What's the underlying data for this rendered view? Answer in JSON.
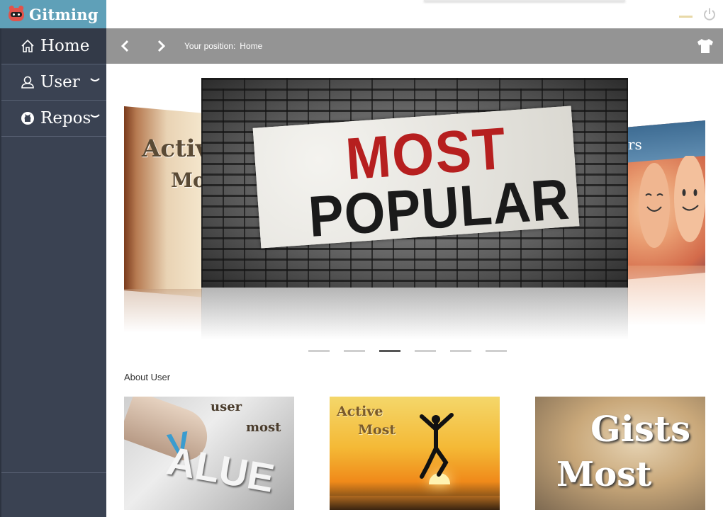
{
  "app": {
    "logo_text": "Gitming"
  },
  "sidebar": {
    "items": [
      {
        "label": "Home",
        "icon": "home-icon"
      },
      {
        "label": "User",
        "icon": "user-icon",
        "chevron": "⌣"
      },
      {
        "label": "Repos",
        "icon": "github-icon",
        "chevron": "⌣"
      }
    ]
  },
  "breadcrumb": {
    "prefix": "Your position:",
    "current": "Home"
  },
  "carousel": {
    "left_slide": {
      "line1": "Activ",
      "line2": "Mo"
    },
    "main_slide": {
      "line1": "MOST",
      "line2": "POPULAR"
    },
    "right_slide": {
      "text": "rs"
    },
    "dot_count": 6,
    "active_dot": 2
  },
  "about": {
    "title": "About User",
    "cards": [
      {
        "line1": "user",
        "line2": "most",
        "big": "ALUE",
        "accent": "V"
      },
      {
        "line1": "Active",
        "line2": "Most"
      },
      {
        "line1": "Gists",
        "line2": "Most"
      }
    ]
  },
  "colors": {
    "sidebar_bg": "#3a4252",
    "logo_bg": "#5fa0b8",
    "crumb_bar_bg": "#949494",
    "accent_red": "#b61f1f"
  }
}
